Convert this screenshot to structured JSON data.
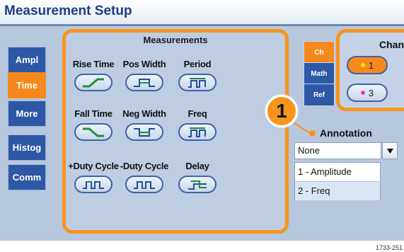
{
  "window": {
    "title": "Measurement Setup"
  },
  "side_tabs": [
    {
      "label": "Ampl",
      "active": false
    },
    {
      "label": "Time",
      "active": true
    },
    {
      "label": "More",
      "active": false
    },
    {
      "label": "Histog",
      "active": false
    },
    {
      "label": "Comm",
      "active": false
    }
  ],
  "measurements": {
    "title": "Measurements",
    "items": [
      {
        "label": "Rise Time",
        "icon": "rise-edge-icon"
      },
      {
        "label": "Pos Width",
        "icon": "pos-pulse-icon"
      },
      {
        "label": "Period",
        "icon": "period-icon"
      },
      {
        "label": "Fall Time",
        "icon": "fall-edge-icon"
      },
      {
        "label": "Neg Width",
        "icon": "neg-pulse-icon"
      },
      {
        "label": "Freq",
        "icon": "freq-icon"
      },
      {
        "label": "+Duty Cycle",
        "icon": "pos-duty-icon"
      },
      {
        "label": "-Duty Cycle",
        "icon": "neg-duty-icon"
      },
      {
        "label": "Delay",
        "icon": "delay-icon"
      }
    ]
  },
  "source_tabs": [
    {
      "label": "Ch",
      "active": true
    },
    {
      "label": "Math",
      "active": false
    },
    {
      "label": "Ref",
      "active": false
    }
  ],
  "channels": {
    "title": "Chann",
    "items": [
      {
        "label": "1",
        "selected": true,
        "dot_color": "#f2e600"
      },
      {
        "label": "3",
        "selected": false,
        "dot_color": "#e040c0"
      }
    ]
  },
  "callout": {
    "number": "1"
  },
  "annotation": {
    "label": "Annotation",
    "selected": "None",
    "options": [
      "1 - Amplitude",
      "2 - Freq"
    ]
  },
  "figure_id": "1733-251",
  "colors": {
    "accent": "#f7941d",
    "tab_blue": "#2d58a6",
    "panel": "#b7c7dd",
    "title": "#1e3e86"
  }
}
